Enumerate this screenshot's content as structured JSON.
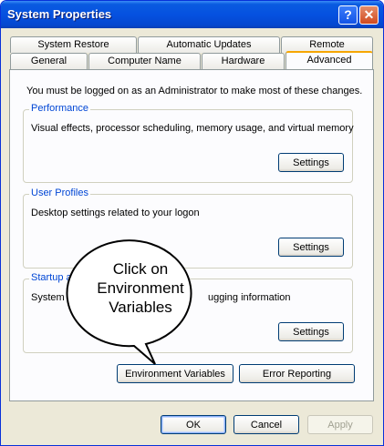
{
  "window": {
    "title": "System Properties",
    "help_glyph": "?",
    "close_glyph": "✕"
  },
  "tabs": {
    "row1": [
      "System Restore",
      "Automatic Updates",
      "Remote"
    ],
    "row2": [
      "General",
      "Computer Name",
      "Hardware",
      "Advanced"
    ]
  },
  "notice": "You must be logged on as an Administrator to make most of these changes.",
  "performance": {
    "title": "Performance",
    "description": "Visual effects, processor scheduling, memory usage, and virtual memory",
    "button": "Settings"
  },
  "profiles": {
    "title": "User Profiles",
    "description": "Desktop settings related to your logon",
    "button": "Settings"
  },
  "startup": {
    "title_visible": "Startup a",
    "description_left": "System s",
    "description_right": "ugging information",
    "button": "Settings"
  },
  "buttons": {
    "env_vars": "Environment Variables",
    "error_reporting": "Error Reporting",
    "ok": "OK",
    "cancel": "Cancel",
    "apply": "Apply"
  },
  "callout": {
    "lines": [
      "Click on",
      "Environment",
      "Variables"
    ]
  }
}
